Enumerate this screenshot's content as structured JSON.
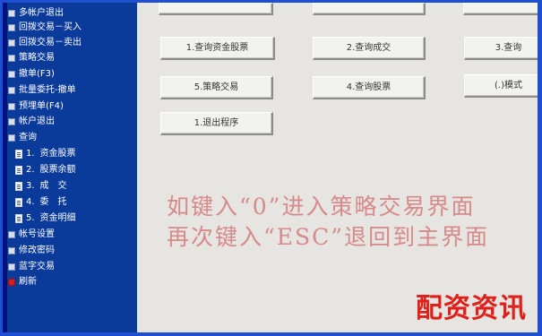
{
  "sidebar": {
    "items": [
      {
        "label": "多帐户退出"
      },
      {
        "label": "回拨交易－买入"
      },
      {
        "label": "回拨交易－卖出"
      },
      {
        "label": "策略交易"
      },
      {
        "label": "撤单(F3)"
      },
      {
        "label": "批量委托-撤单"
      },
      {
        "label": "预埋单(F4)"
      },
      {
        "label": "帐户退出"
      },
      {
        "label": "查询"
      }
    ],
    "sub_items": [
      {
        "num": "1.",
        "label": "资金股票"
      },
      {
        "num": "2.",
        "label": "股票余额"
      },
      {
        "num": "3.",
        "label": "成　交"
      },
      {
        "num": "4.",
        "label": "委　托"
      },
      {
        "num": "5.",
        "label": "资金明细"
      }
    ],
    "bottom_items": [
      {
        "label": "帐号设置"
      },
      {
        "label": "修改密码"
      },
      {
        "label": "蓝字交易"
      },
      {
        "label": "刷新"
      }
    ]
  },
  "main": {
    "buttons": [
      {
        "label": "1.查询资金股票"
      },
      {
        "label": "2.查询成交"
      },
      {
        "label": "3.查询"
      },
      {
        "label": "5.策略交易"
      },
      {
        "label": "4.查询股票"
      },
      {
        "label": "(.)模式"
      },
      {
        "label": "1.退出程序"
      }
    ],
    "tip_line1": "如键入“0”进入策略交易界面",
    "tip_line2": "再次键入“ESC”退回到主界面"
  },
  "watermark": "配资资讯",
  "colors": {
    "sidebar_bg": "#0a3a9a",
    "main_bg": "#e6e5e1",
    "frame_border": "#1d4fd0",
    "tip_text": "#d68a8a",
    "watermark": "#e0201a"
  }
}
